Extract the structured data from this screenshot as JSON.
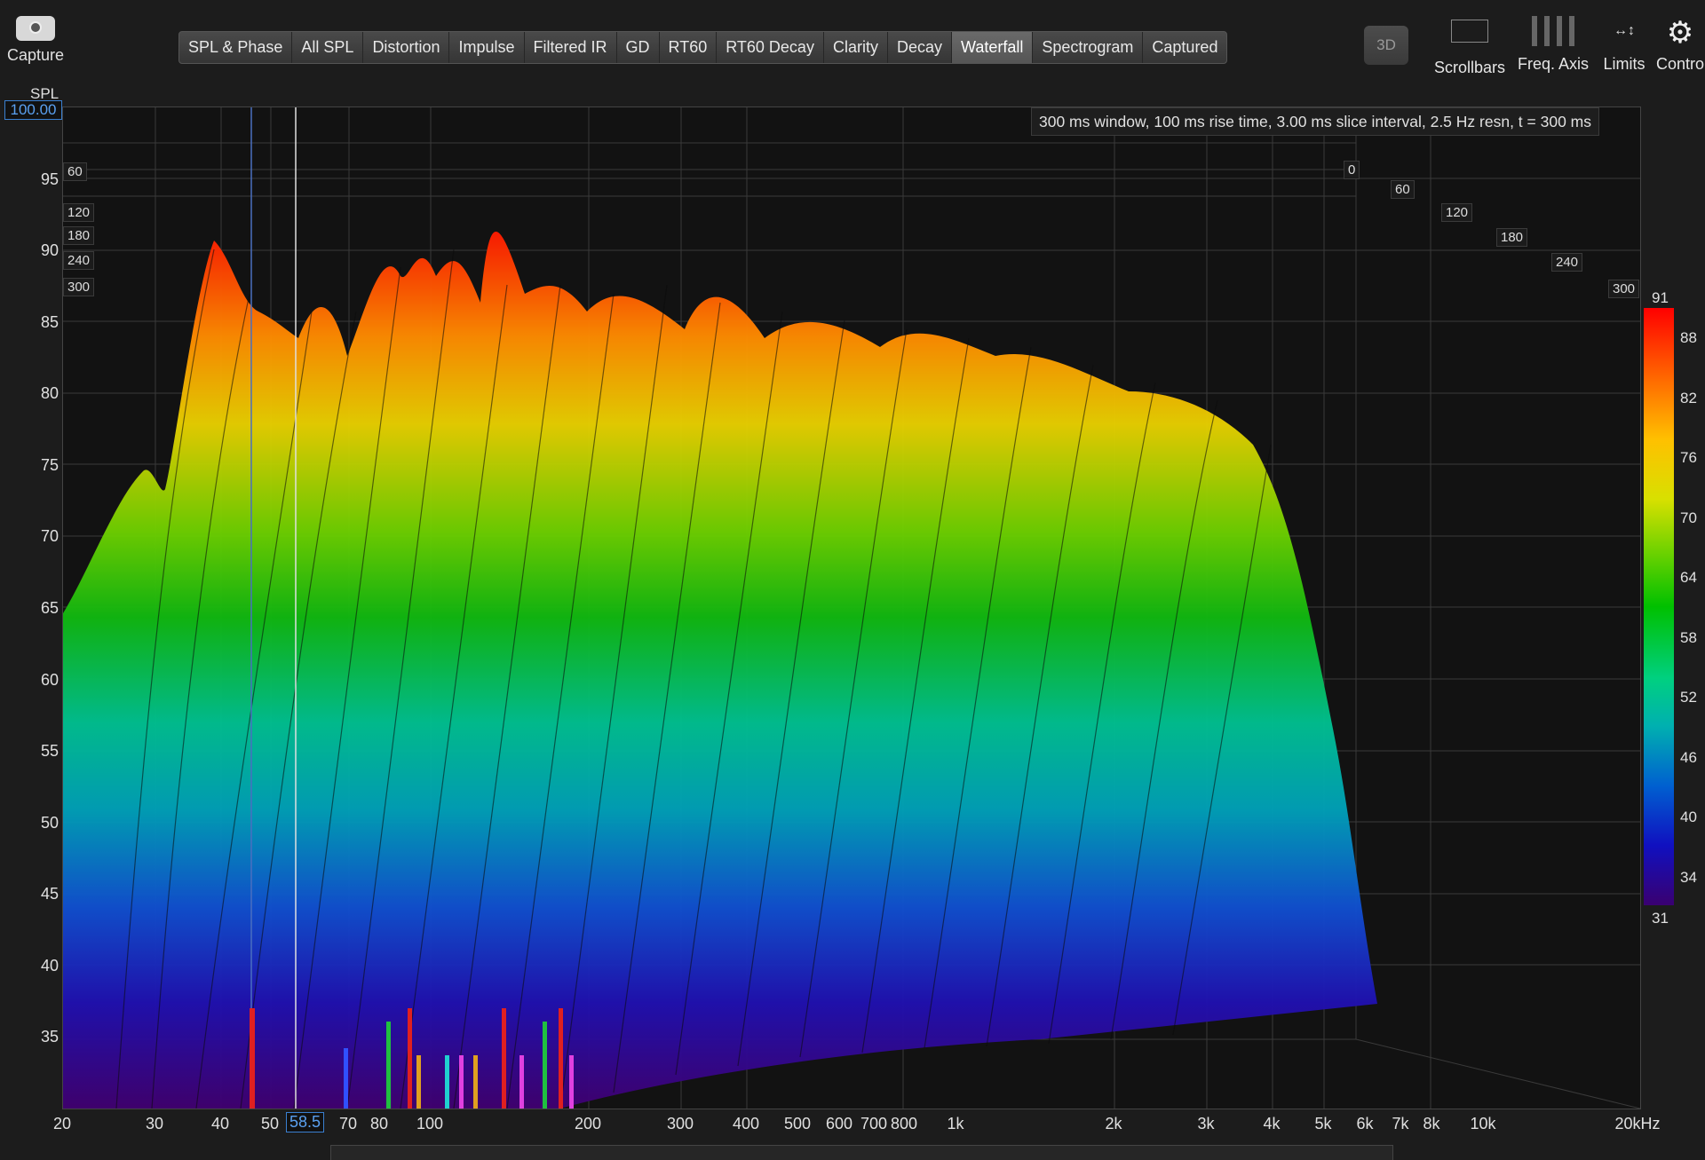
{
  "toolbar": {
    "capture_label": "Capture",
    "tabs": [
      "SPL & Phase",
      "All SPL",
      "Distortion",
      "Impulse",
      "Filtered IR",
      "GD",
      "RT60",
      "RT60 Decay",
      "Clarity",
      "Decay",
      "Waterfall",
      "Spectrogram",
      "Captured"
    ],
    "active_tab": "Waterfall",
    "btn_3d": "3D",
    "scrollbars_label": "Scrollbars",
    "freq_axis_label": "Freq. Axis",
    "limits_label": "Limits",
    "controls_label": "Contro"
  },
  "graph": {
    "info_text": "300 ms window, 100 ms rise time, 3.00 ms slice interval, 2.5 Hz resn, t = 300 ms",
    "y_axis_title": "SPL",
    "y_max_value": "100.00",
    "y_ticks": [
      "95",
      "90",
      "85",
      "80",
      "75",
      "70",
      "65",
      "60",
      "55",
      "50",
      "45",
      "40",
      "35"
    ],
    "x_ticks": [
      "20",
      "30",
      "40",
      "50",
      "70",
      "80",
      "100",
      "200",
      "300",
      "400",
      "500",
      "600",
      "700",
      "800",
      "1k",
      "2k",
      "3k",
      "4k",
      "5k",
      "6k",
      "7k",
      "8k",
      "10k",
      "20kHz"
    ],
    "cursor_freq": "58.5",
    "time_ticks_left": [
      "0",
      "60",
      "120",
      "180",
      "240",
      "300"
    ],
    "time_ticks_right": [
      "0",
      "60",
      "120",
      "180",
      "240",
      "300"
    ],
    "colorbar_ticks": [
      "91",
      "88",
      "82",
      "76",
      "70",
      "64",
      "58",
      "52",
      "46",
      "40",
      "34",
      "31"
    ]
  },
  "colors": {
    "accent": "#3a7fd0",
    "background": "#1c1c1c",
    "plot_bg": "#121212"
  }
}
